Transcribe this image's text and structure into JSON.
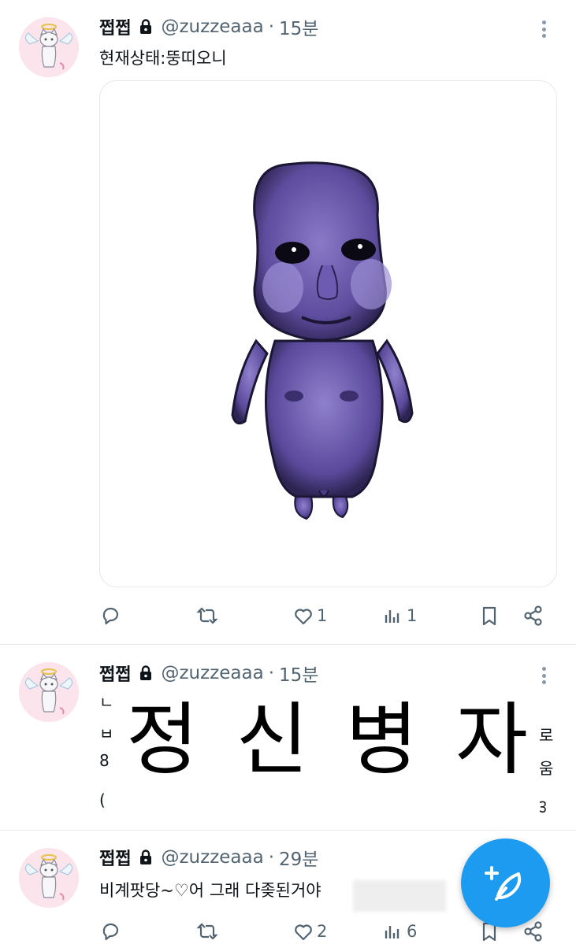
{
  "tweets": [
    {
      "name": "쩝쩝",
      "handle": "@zuzzeaaa",
      "separator": "·",
      "time": "15분",
      "text": "현재상태:뚱띠오니",
      "actions": {
        "reply": "",
        "retweet": "",
        "like": "1",
        "views": "1"
      }
    },
    {
      "name": "쩝쩝",
      "handle": "@zuzzeaaa",
      "separator": "·",
      "time": "15분",
      "overlay": [
        "정",
        "신",
        "병",
        "자"
      ],
      "peek_left": [
        "ㄴ",
        "ㅂ",
        "8",
        "("
      ],
      "peek_right": [
        "로",
        "움",
        "ᢃ"
      ]
    },
    {
      "name": "쩝쩝",
      "handle": "@zuzzeaaa",
      "separator": "·",
      "time": "29분",
      "text": "비계팟당~♡어 그래 다좆된거야",
      "actions": {
        "reply": "",
        "retweet": "",
        "like": "2",
        "views": "6"
      }
    }
  ],
  "icons": {
    "lock": "lock-icon",
    "more": "more-vertical-icon",
    "reply": "reply-icon",
    "retweet": "retweet-icon",
    "like": "heart-icon",
    "views": "views-icon",
    "bookmark": "bookmark-icon",
    "share": "share-icon",
    "compose": "compose-feather-icon"
  },
  "colors": {
    "accent": "#1d9bf0",
    "secondary_text": "#536471",
    "figure_purple": "#6c5ba8"
  }
}
